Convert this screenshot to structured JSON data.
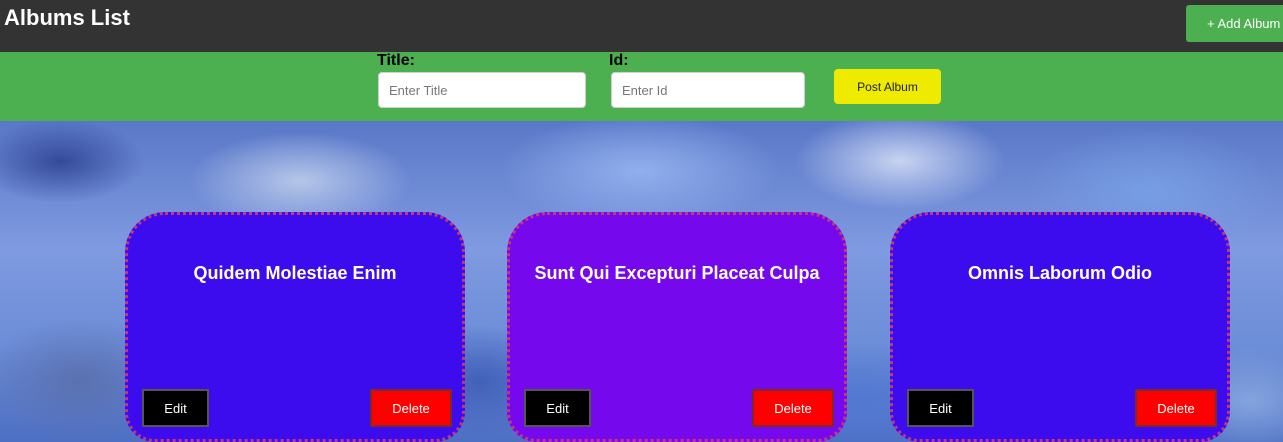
{
  "header": {
    "title": "Albums List",
    "add_album_label": "+ Add Album"
  },
  "form": {
    "title_label": "Title:",
    "title_placeholder": "Enter Title",
    "id_label": "Id:",
    "id_placeholder": "Enter Id",
    "post_label": "Post Album"
  },
  "albums": [
    {
      "title": "Quidem Molestiae Enim",
      "edit_label": "Edit",
      "delete_label": "Delete",
      "color": "#3c0cef"
    },
    {
      "title": "Sunt Qui Excepturi Placeat Culpa",
      "edit_label": "Edit",
      "delete_label": "Delete",
      "color": "#7608ee"
    },
    {
      "title": "Omnis Laborum Odio",
      "edit_label": "Edit",
      "delete_label": "Delete",
      "color": "#3c0cef"
    }
  ],
  "colors": {
    "topbar": "#333333",
    "accent_green": "#4caf50",
    "post_button": "#eeea00",
    "delete_button": "#ff0000",
    "card_border": "#c0397a"
  }
}
